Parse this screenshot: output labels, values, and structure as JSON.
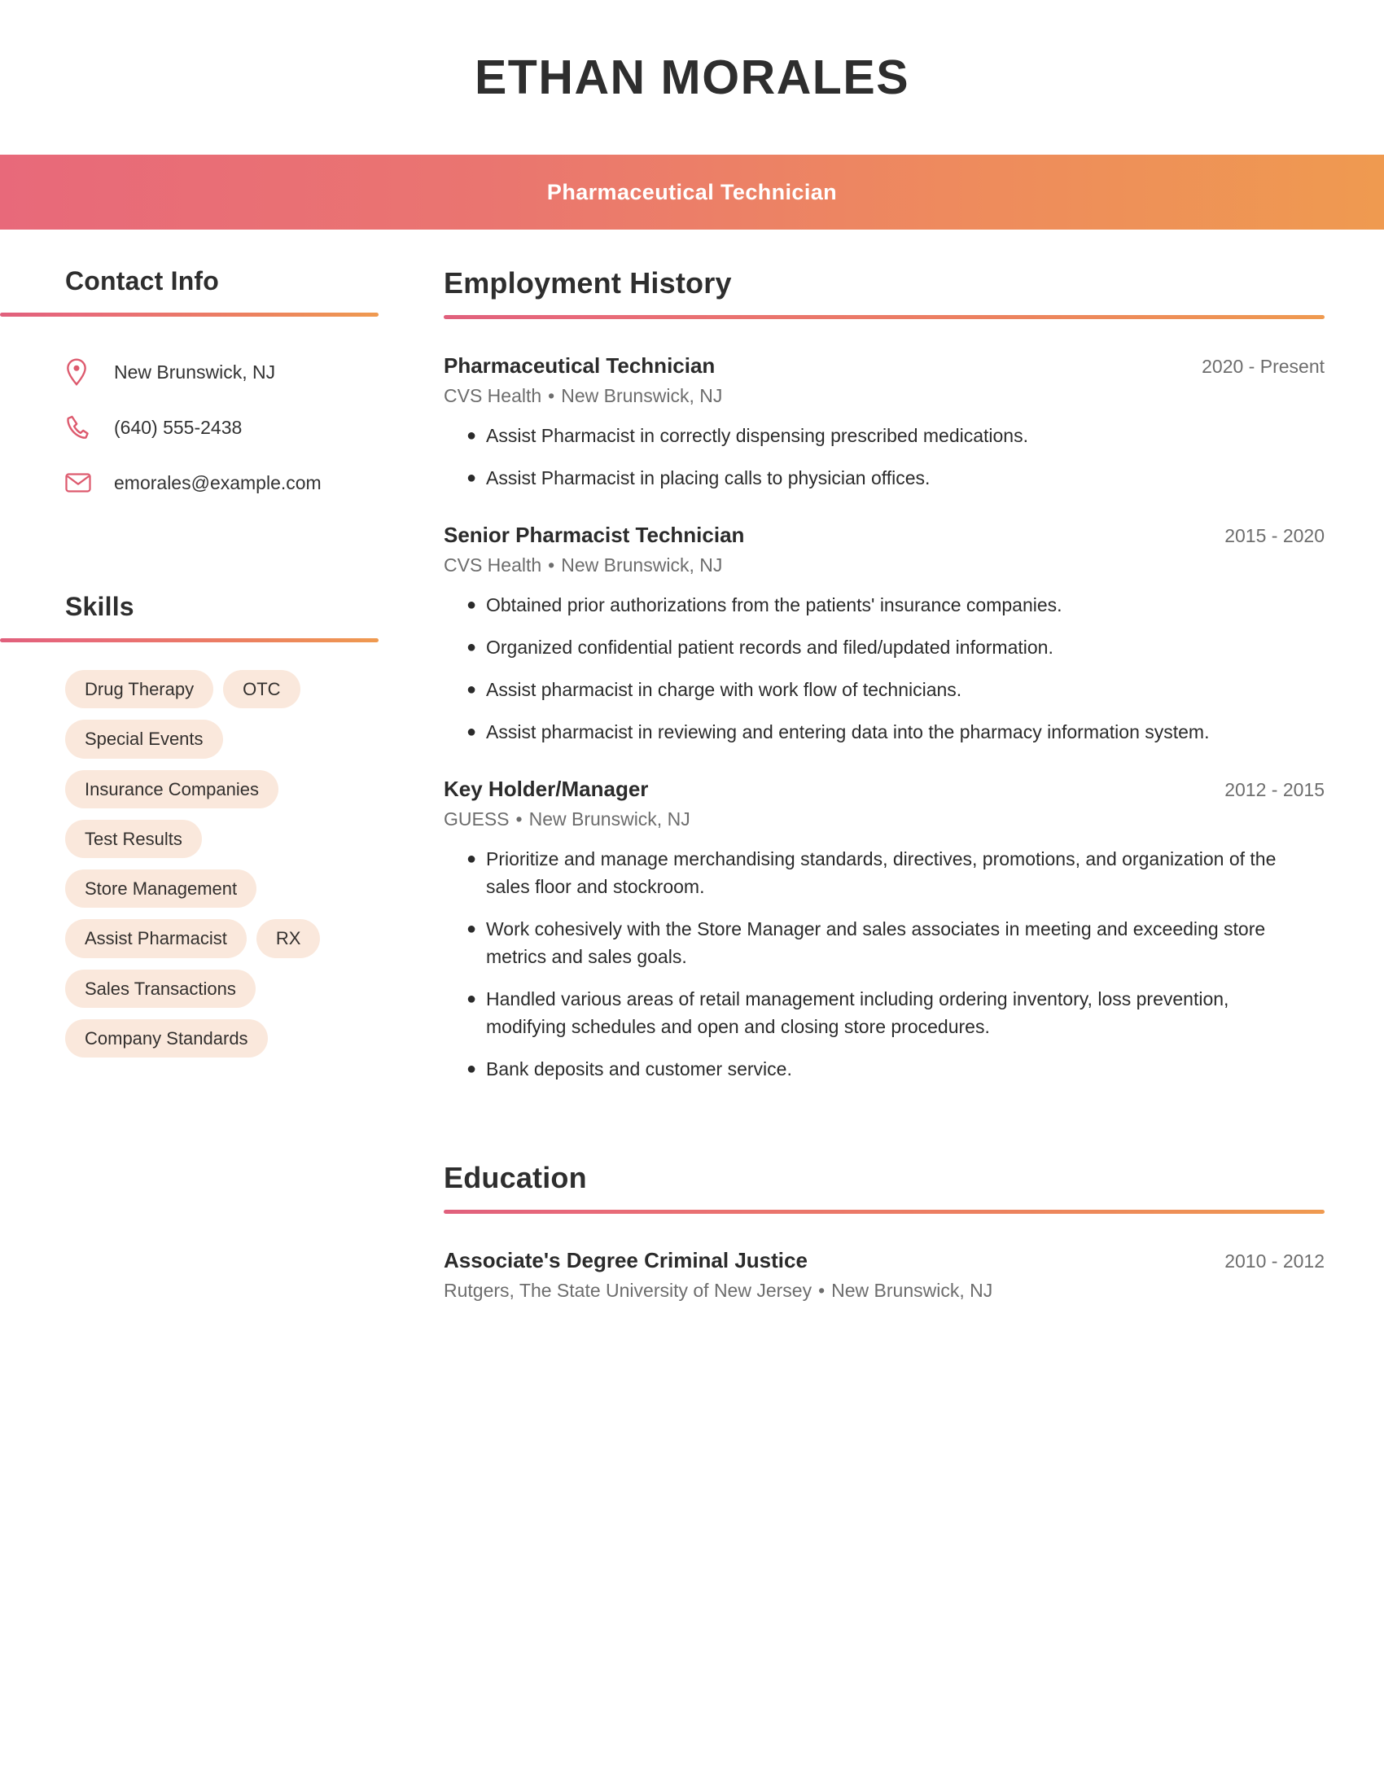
{
  "header": {
    "full_name": "ETHAN MORALES",
    "job_title": "Pharmaceutical Technician",
    "band_gradient_start": "#e8697a",
    "band_gradient_end": "#ef9a50"
  },
  "sidebar": {
    "contact": {
      "heading": "Contact Info",
      "items": [
        {
          "icon": "location-pin-icon",
          "value": "New Brunswick, NJ"
        },
        {
          "icon": "phone-icon",
          "value": "(640) 555-2438"
        },
        {
          "icon": "envelope-icon",
          "value": "emorales@example.com"
        }
      ]
    },
    "skills": {
      "heading": "Skills",
      "tag_background": "#fae8dc",
      "items": [
        "Drug Therapy",
        "OTC",
        "Special Events",
        "Insurance Companies",
        "Test Results",
        "Store Management",
        "Assist Pharmacist",
        "RX",
        "Sales Transactions",
        "Company Standards"
      ]
    }
  },
  "main": {
    "employment": {
      "heading": "Employment History",
      "entries": [
        {
          "role": "Pharmaceutical Technician",
          "date": "2020 - Present",
          "company": "CVS Health",
          "separator": "•",
          "location": "New Brunswick, NJ",
          "bullets": [
            "Assist Pharmacist in correctly dispensing prescribed medications.",
            "Assist Pharmacist in placing calls to physician offices."
          ]
        },
        {
          "role": "Senior Pharmacist Technician",
          "date": "2015 - 2020",
          "company": "CVS Health",
          "separator": "•",
          "location": "New Brunswick, NJ",
          "bullets": [
            "Obtained prior authorizations from the patients' insurance companies.",
            "Organized confidential patient records and filed/updated information.",
            "Assist pharmacist in charge with work flow of technicians.",
            "Assist pharmacist in reviewing and entering data into the pharmacy information system."
          ]
        },
        {
          "role": "Key Holder/Manager",
          "date": "2012 - 2015",
          "company": "GUESS",
          "separator": "•",
          "location": "New Brunswick, NJ",
          "bullets": [
            "Prioritize and manage merchandising standards, directives, promotions, and organization of the sales floor and stockroom.",
            "Work cohesively with the Store Manager and sales associates in meeting and exceeding store metrics and sales goals.",
            "Handled various areas of retail management including ordering inventory, loss prevention, modifying schedules and open and closing store procedures.",
            "Bank deposits and customer service."
          ]
        }
      ]
    },
    "education": {
      "heading": "Education",
      "entries": [
        {
          "degree": "Associate's Degree Criminal Justice",
          "date": "2010 - 2012",
          "school": "Rutgers, The State University of New Jersey",
          "separator": "•",
          "location": "New Brunswick, NJ"
        }
      ]
    }
  },
  "theme": {
    "accent_pink": "#e0607c",
    "accent_orange": "#ef9a50",
    "icon_color": "#dd5a6e",
    "text_dark": "#2b2b2b",
    "text_muted": "#6d6d6d"
  }
}
